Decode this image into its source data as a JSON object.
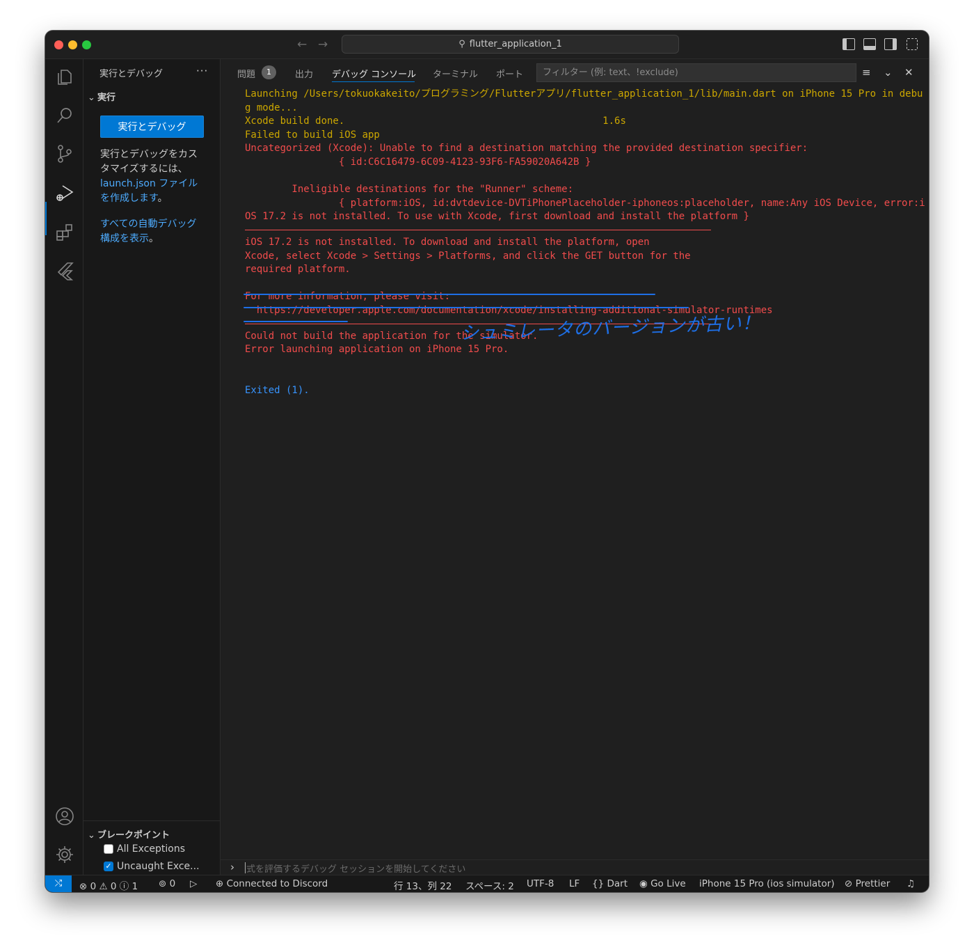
{
  "titlebar": {
    "search_text": "flutter_application_1"
  },
  "sidebar": {
    "title": "実行とデバッグ",
    "more": "···",
    "section": "実行",
    "run_button": "実行とデバッグ",
    "desc_part1": "実行とデバッグをカスタマイズするには、",
    "desc_link": "launch.json ファイルを作成します",
    "desc_part2": "。",
    "auto_debug_link": "すべての自動デバッグ構成を表示",
    "auto_debug_end": "。",
    "breakpoints_title": "ブレークポイント",
    "bp_items": [
      {
        "label": "All Exceptions",
        "checked": false
      },
      {
        "label": "Uncaught Exce...",
        "checked": true
      }
    ]
  },
  "panel": {
    "tabs": [
      "問題",
      "出力",
      "デバッグ コンソール",
      "ターミナル",
      "ポート"
    ],
    "problems_badge": "1",
    "filter_placeholder": "フィルター (例: text、!exclude)",
    "repl_placeholder": "式を評価するデバッグ セッションを開始してください"
  },
  "console": {
    "line1": "Launching /Users/tokuokakeito/プログラミング/Flutterアプリ/flutter_application_1/lib/main.dart on iPhone 15 Pro in debu",
    "line2": "g mode...",
    "line3": "Xcode build done.                                            1.6s",
    "line4": "Failed to build iOS app",
    "line5": "Uncategorized (Xcode): Unable to find a destination matching the provided destination specifier:",
    "line6": "                { id:C6C16479-6C09-4123-93F6-FA59020A642B }",
    "line7": "",
    "line8": "        Ineligible destinations for the \"Runner\" scheme:",
    "line9": "                { platform:iOS, id:dvtdevice-DVTiPhonePlaceholder-iphoneos:placeholder, name:Any iOS Device, error:i",
    "line10": "OS 17.2 is not installed. To use with Xcode, first download and install the platform }",
    "line11": "iOS 17.2 is not installed. To download and install the platform, open",
    "line12": "Xcode, select Xcode > Settings > Platforms, and click the GET button for the",
    "line13": "required platform.",
    "line14": "",
    "line15": "For more information, please visit:",
    "line16": "  https://developer.apple.com/documentation/xcode/installing-additional-simulator-runtimes",
    "line17": "Could not build the application for the simulator.",
    "line18": "Error launching application on iPhone 15 Pro.",
    "exited": "Exited (1).",
    "annotation": "シュミレータのバージョンが古い！"
  },
  "statusbar": {
    "errors": "0",
    "warnings": "0",
    "infos": "1",
    "ports": "0",
    "discord": "Connected to Discord",
    "position": "行 13、列 22",
    "spaces": "スペース: 2",
    "encoding": "UTF-8",
    "eol": "LF",
    "language": "Dart",
    "golive": "Go Live",
    "device": "iPhone 15 Pro (ios simulator)",
    "prettier": "Prettier"
  },
  "colors": {
    "accent": "#0078d4",
    "error": "#f14c4c",
    "warning": "#cca700",
    "info": "#3794ff",
    "annotation": "#1e6fe6"
  }
}
